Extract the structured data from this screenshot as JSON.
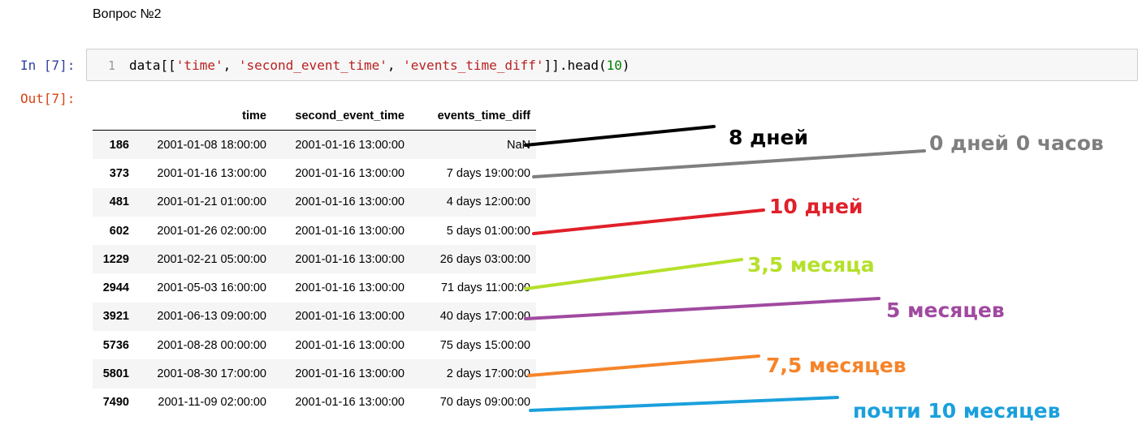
{
  "markdown": {
    "text": "Вопрос №2"
  },
  "cell": {
    "in_prompt": "In [7]:",
    "out_prompt": "Out[7]:",
    "line_number": "1",
    "code": {
      "prefix": "data[[",
      "s1": "'time'",
      "sep1": ", ",
      "s2": "'second_event_time'",
      "sep2": ", ",
      "s3": "'events_time_diff'",
      "mid": "]].head(",
      "num": "10",
      "suffix": ")"
    }
  },
  "table": {
    "columns": [
      "",
      "time",
      "second_event_time",
      "events_time_diff"
    ],
    "rows": [
      {
        "index": "186",
        "time": "2001-01-08 18:00:00",
        "second": "2001-01-16 13:00:00",
        "diff": "NaN"
      },
      {
        "index": "373",
        "time": "2001-01-16 13:00:00",
        "second": "2001-01-16 13:00:00",
        "diff": "7 days 19:00:00"
      },
      {
        "index": "481",
        "time": "2001-01-21 01:00:00",
        "second": "2001-01-16 13:00:00",
        "diff": "4 days 12:00:00"
      },
      {
        "index": "602",
        "time": "2001-01-26 02:00:00",
        "second": "2001-01-16 13:00:00",
        "diff": "5 days 01:00:00"
      },
      {
        "index": "1229",
        "time": "2001-02-21 05:00:00",
        "second": "2001-01-16 13:00:00",
        "diff": "26 days 03:00:00"
      },
      {
        "index": "2944",
        "time": "2001-05-03 16:00:00",
        "second": "2001-01-16 13:00:00",
        "diff": "71 days 11:00:00"
      },
      {
        "index": "3921",
        "time": "2001-06-13 09:00:00",
        "second": "2001-01-16 13:00:00",
        "diff": "40 days 17:00:00"
      },
      {
        "index": "5736",
        "time": "2001-08-28 00:00:00",
        "second": "2001-01-16 13:00:00",
        "diff": "75 days 15:00:00"
      },
      {
        "index": "5801",
        "time": "2001-08-30 17:00:00",
        "second": "2001-01-16 13:00:00",
        "diff": "2 days 17:00:00"
      },
      {
        "index": "7490",
        "time": "2001-11-09 02:00:00",
        "second": "2001-01-16 13:00:00",
        "diff": "70 days 09:00:00"
      }
    ]
  },
  "annotations": [
    {
      "text": "8 дней",
      "color": "#000000"
    },
    {
      "text": "0 дней 0 часов",
      "color": "#7f7f7f"
    },
    {
      "text": "10 дней",
      "color": "#e0202a"
    },
    {
      "text": "3,5 месяца",
      "color": "#b5e02a"
    },
    {
      "text": "5 месяцев",
      "color": "#a04aa0"
    },
    {
      "text": "7,5 месяцев",
      "color": "#f5842a"
    },
    {
      "text": "почти 10 месяцев",
      "color": "#1aa0dc"
    }
  ]
}
